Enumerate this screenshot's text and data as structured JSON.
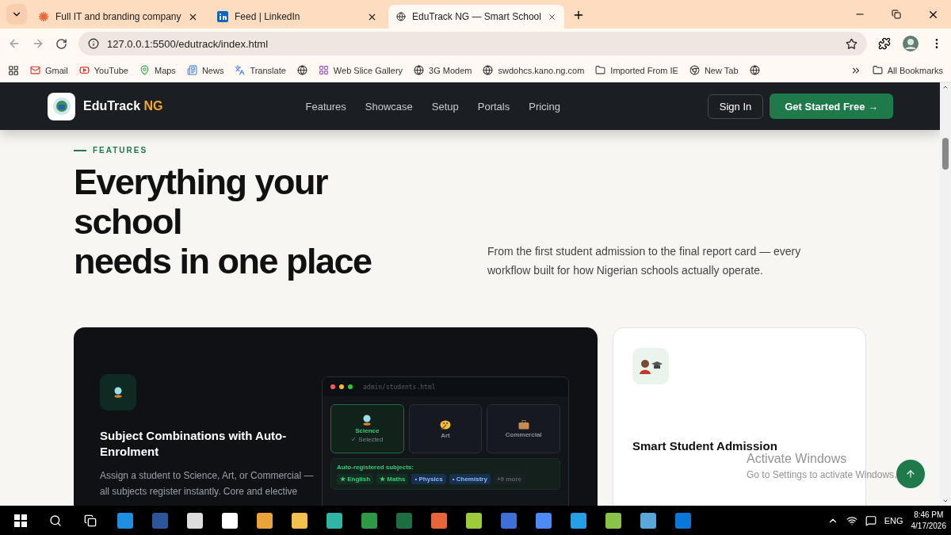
{
  "browser": {
    "tabs": [
      {
        "title": "Full IT and branding company",
        "kind": "burst",
        "selected": false
      },
      {
        "title": "Feed | LinkedIn",
        "kind": "linkedin",
        "selected": false
      },
      {
        "title": "EduTrack NG — Smart School",
        "kind": "globe",
        "selected": true
      }
    ],
    "url": "127.0.0.1:5500/edutrack/index.html",
    "bookmarks": [
      {
        "label": "Gmail",
        "kind": "mail"
      },
      {
        "label": "YouTube",
        "kind": "video"
      },
      {
        "label": "Maps",
        "kind": "pin"
      },
      {
        "label": "News",
        "kind": "news"
      },
      {
        "label": "Translate",
        "kind": "translate"
      },
      {
        "kind": "globe"
      },
      {
        "label": "Web Slice Gallery",
        "kind": "slice"
      },
      {
        "label": "3G Modem",
        "kind": "globe"
      },
      {
        "label": "swdohcs.kano.ng.com",
        "kind": "globe"
      },
      {
        "label": "Imported From IE",
        "kind": "folder"
      },
      {
        "label": "New Tab",
        "kind": "chrome"
      },
      {
        "kind": "globe"
      }
    ],
    "all_bookmarks": "All Bookmarks"
  },
  "nav": {
    "brand": "EduTrack",
    "brand_accent": "NG",
    "links": [
      "Features",
      "Showcase",
      "Setup",
      "Portals",
      "Pricing"
    ],
    "sign_in": "Sign In",
    "cta": "Get Started Free →"
  },
  "section": {
    "eyebrow": "FEATURES",
    "heading": [
      "Everything your",
      "school",
      "needs in one place"
    ],
    "intro": "From the first student admission to the final report card — every workflow built for how Nigerian schools actually operate."
  },
  "feature_card": {
    "title": "Subject Combinations with Auto-Enrolment",
    "body": "Assign a student to Science, Art, or Commercial — all subjects register instantly. Core and elective",
    "mockup": {
      "path": "admin/students.html",
      "streams": [
        {
          "label": "Science",
          "kind": "science",
          "note": "✓ Selected",
          "selected": true
        },
        {
          "label": "Art",
          "kind": "art",
          "selected": false
        },
        {
          "label": "Commercial",
          "kind": "commercial",
          "selected": false
        }
      ],
      "subjects_label": "Auto-registered subjects:",
      "subjects": [
        {
          "label": "★ English",
          "kind": "core"
        },
        {
          "label": "★ Maths",
          "kind": "core"
        },
        {
          "label": "• Physics",
          "kind": "elective"
        },
        {
          "label": "• Chemistry",
          "kind": "elective"
        },
        {
          "label": "+9 more",
          "kind": "more"
        }
      ]
    }
  },
  "side_card": {
    "title": "Smart Student Admission"
  },
  "os_notice": {
    "title": "Activate Windows",
    "subtitle": "Go to Settings to activate Windows."
  },
  "taskbar": {
    "language": "ENG",
    "time": "8:46 PM",
    "date": "4/17/2026"
  }
}
